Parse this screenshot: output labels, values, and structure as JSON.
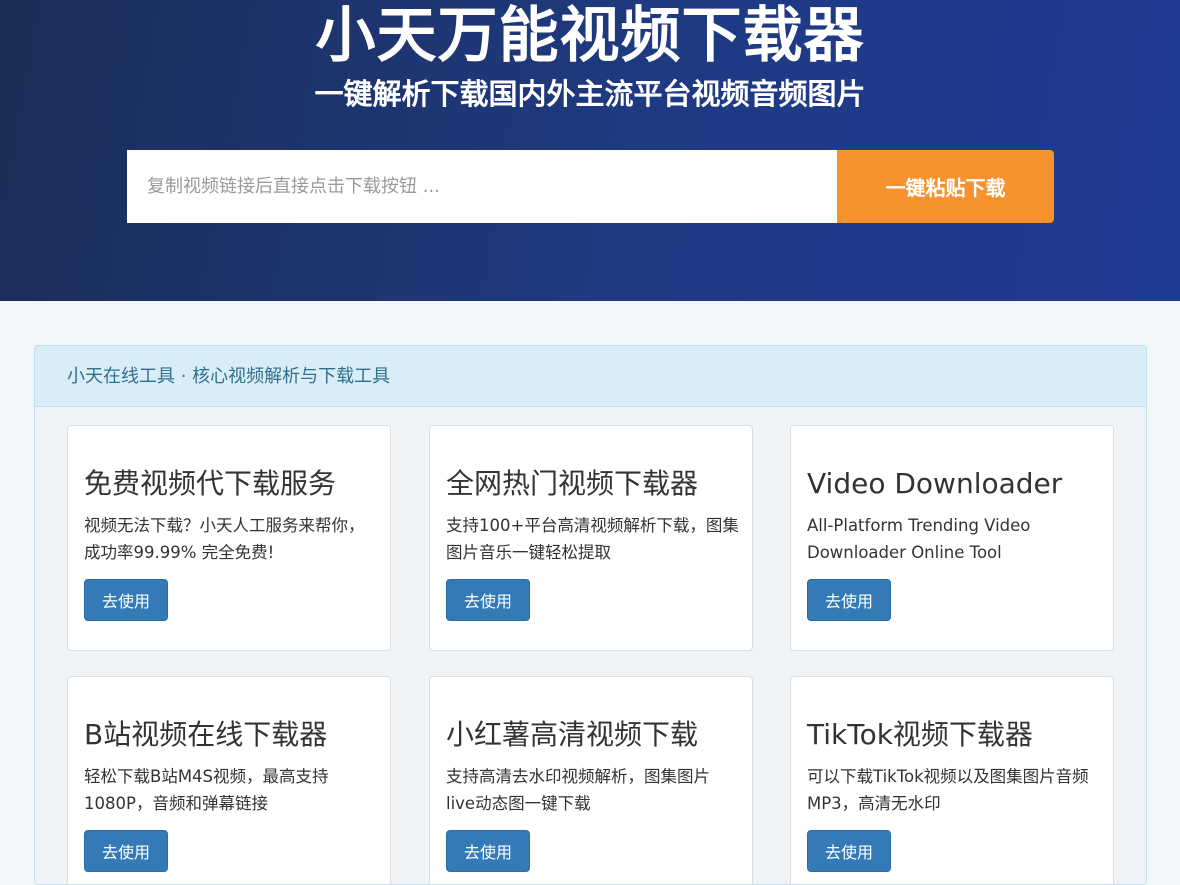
{
  "hero": {
    "title": "小天万能视频下载器",
    "subtitle": "一键解析下载国内外主流平台视频音频图片",
    "search_placeholder": "复制视频链接后直接点击下载按钮 ...",
    "search_value": "",
    "paste_button_label": "一键粘贴下载"
  },
  "panel": {
    "heading": "小天在线工具 · 核心视频解析与下载工具"
  },
  "cards": [
    {
      "title": "免费视频代下载服务",
      "description": "视频无法下载？小天人工服务来帮你，成功率99.99% 完全免费!",
      "button_label": "去使用"
    },
    {
      "title": "全网热门视频下载器",
      "description": "支持100+平台高清视频解析下载，图集图片音乐一键轻松提取",
      "button_label": "去使用"
    },
    {
      "title": "Video Downloader",
      "description": "All-Platform Trending Video Downloader Online Tool",
      "button_label": "去使用"
    },
    {
      "title": "B站视频在线下载器",
      "description": "轻松下载B站M4S视频，最高支持1080P，音频和弹幕链接",
      "button_label": "去使用"
    },
    {
      "title": "小红薯高清视频下载",
      "description": "支持高清去水印视频解析，图集图片 live动态图一键下载",
      "button_label": "去使用"
    },
    {
      "title": "TikTok视频下载器",
      "description": "可以下载TikTok视频以及图集图片音频MP3，高清无水印",
      "button_label": "去使用"
    }
  ],
  "colors": {
    "hero_gradient_start": "#1b2d56",
    "hero_gradient_end": "#1f3a92",
    "accent_orange": "#f7932f",
    "primary_blue": "#337ab7",
    "panel_heading_bg": "#d9edf7",
    "panel_heading_text": "#31708f"
  }
}
